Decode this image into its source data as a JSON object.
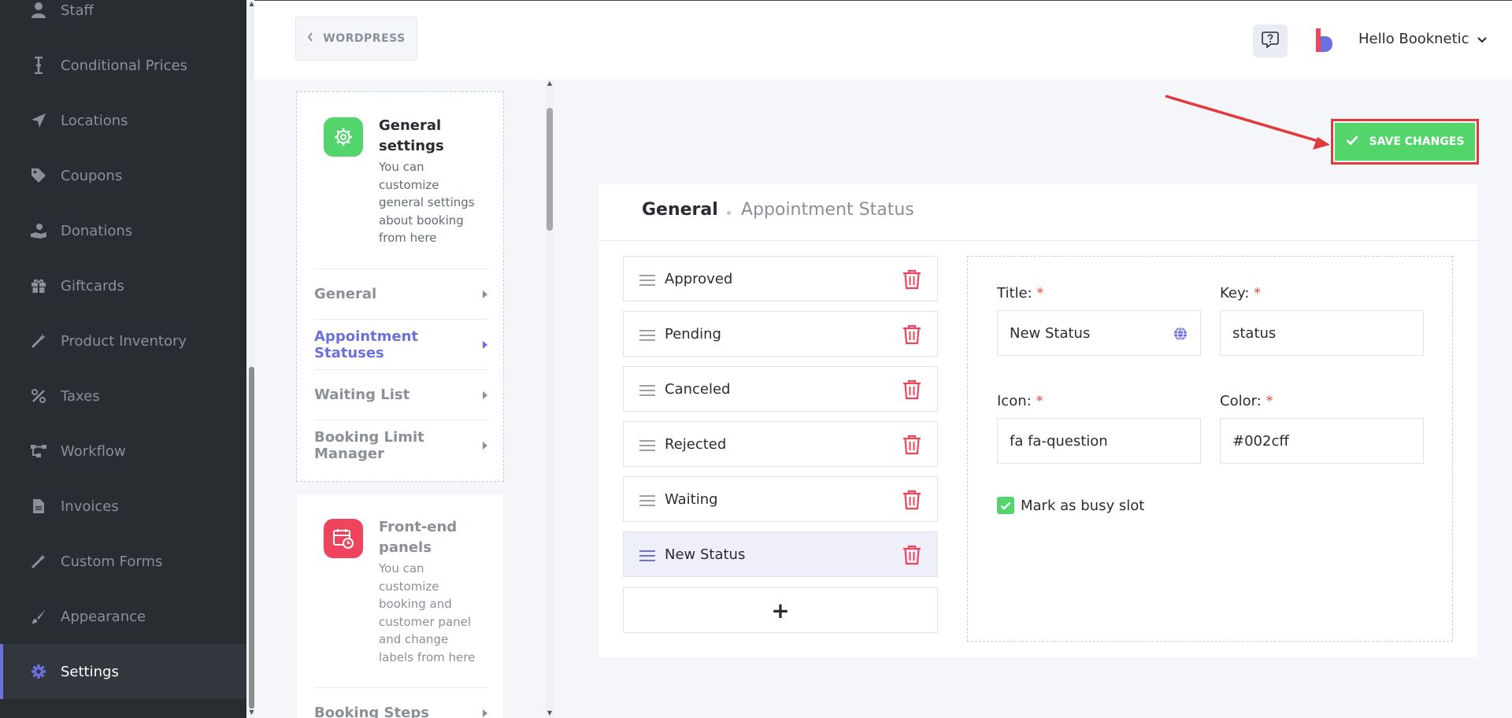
{
  "sidebar": {
    "items": [
      {
        "label": "Staff",
        "icon": "user-icon"
      },
      {
        "label": "Conditional Prices",
        "icon": "i-beam-icon"
      },
      {
        "label": "Locations",
        "icon": "location-arrow-icon"
      },
      {
        "label": "Coupons",
        "icon": "tag-icon"
      },
      {
        "label": "Donations",
        "icon": "hand-holding-icon"
      },
      {
        "label": "Giftcards",
        "icon": "gift-icon"
      },
      {
        "label": "Product Inventory",
        "icon": "magic-wand-icon"
      },
      {
        "label": "Taxes",
        "icon": "percent-icon"
      },
      {
        "label": "Workflow",
        "icon": "workflow-icon"
      },
      {
        "label": "Invoices",
        "icon": "document-icon"
      },
      {
        "label": "Custom Forms",
        "icon": "magic-wand-icon"
      },
      {
        "label": "Appearance",
        "icon": "brush-icon"
      },
      {
        "label": "Settings",
        "icon": "gear-icon",
        "active": true
      }
    ]
  },
  "topbar": {
    "back_label": "WORDPRESS",
    "user_greeting": "Hello Booknetic"
  },
  "settings_menu": {
    "general": {
      "title": "General settings",
      "description": "You can customize general settings about booking from here",
      "links": [
        "General",
        "Appointment Statuses",
        "Waiting List",
        "Booking Limit Manager"
      ],
      "active_link": "Appointment Statuses"
    },
    "frontend": {
      "title": "Front-end panels",
      "description": "You can customize booking and customer panel and change labels from here",
      "links": [
        "Booking Steps"
      ]
    }
  },
  "save_button": {
    "label": "SAVE CHANGES"
  },
  "breadcrumb": {
    "section": "General",
    "page": "Appointment Status"
  },
  "statuses": [
    "Approved",
    "Pending",
    "Canceled",
    "Rejected",
    "Waiting",
    "New Status"
  ],
  "selected_status": "New Status",
  "add_button": {
    "label": "+"
  },
  "form": {
    "title_label": "Title:",
    "title_value": "New Status",
    "key_label": "Key:",
    "key_value": "status",
    "icon_label": "Icon:",
    "icon_value": "fa fa-question",
    "color_label": "Color:",
    "color_value": "#002cff",
    "required_mark": "*",
    "busy_slot_label": "Mark as busy slot",
    "busy_slot_checked": true
  },
  "colors": {
    "sidebar_bg": "#292d32",
    "accent": "#6c70dc",
    "success": "#53d56c",
    "danger": "#f0435e",
    "annotation": "#e03a3a"
  }
}
